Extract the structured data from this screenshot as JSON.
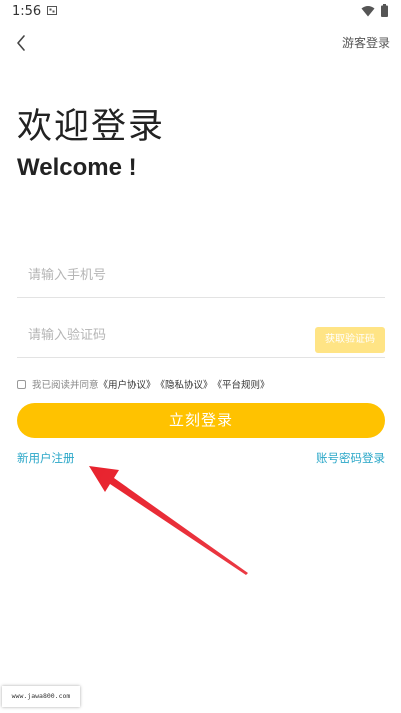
{
  "status_bar": {
    "time": "1:56",
    "icons": [
      "sim-icon",
      "wifi-icon",
      "battery-icon"
    ]
  },
  "header": {
    "back_icon": "back-chevron-icon",
    "guest_login": "游客登录"
  },
  "welcome": {
    "title_cn": "欢迎登录",
    "title_en": "Welcome !"
  },
  "form": {
    "phone_placeholder": "请输入手机号",
    "phone_value": "",
    "code_placeholder": "请输入验证码",
    "code_value": "",
    "get_code_label": "获取验证码",
    "agreement": {
      "checked": false,
      "prefix": "我已阅读并同意",
      "user_agreement": "《用户协议》",
      "privacy_agreement": "《隐私协议》",
      "platform_rules": "《平台规则》"
    },
    "login_label": "立刻登录"
  },
  "links": {
    "register": "新用户注册",
    "password_login": "账号密码登录"
  },
  "watermark": "www.jawa800.com",
  "colors": {
    "primary": "#ffc200",
    "primary_disabled": "#ffe485",
    "link": "#2aa7c8",
    "annotation_arrow": "#e8232e"
  }
}
